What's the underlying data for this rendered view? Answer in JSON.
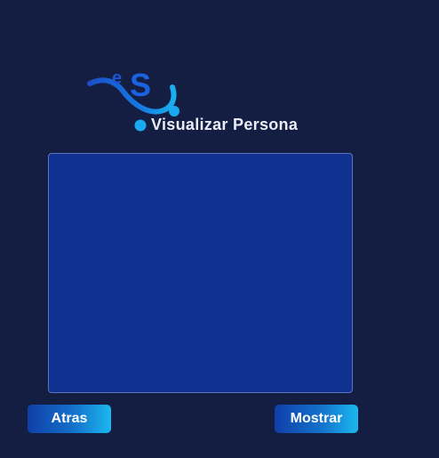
{
  "header": {
    "logo_text": "eS",
    "title": "Visualizar Persona"
  },
  "buttons": {
    "back_label": "Atras",
    "show_label": "Mostrar"
  },
  "colors": {
    "background": "#141e43",
    "panel": "#10318f",
    "panel_border": "#5d74be",
    "button_start": "#0f3fa8",
    "button_end": "#1ab8ee",
    "logo_accent": "#1aa9f0",
    "logo_dark": "#1a56d6"
  }
}
